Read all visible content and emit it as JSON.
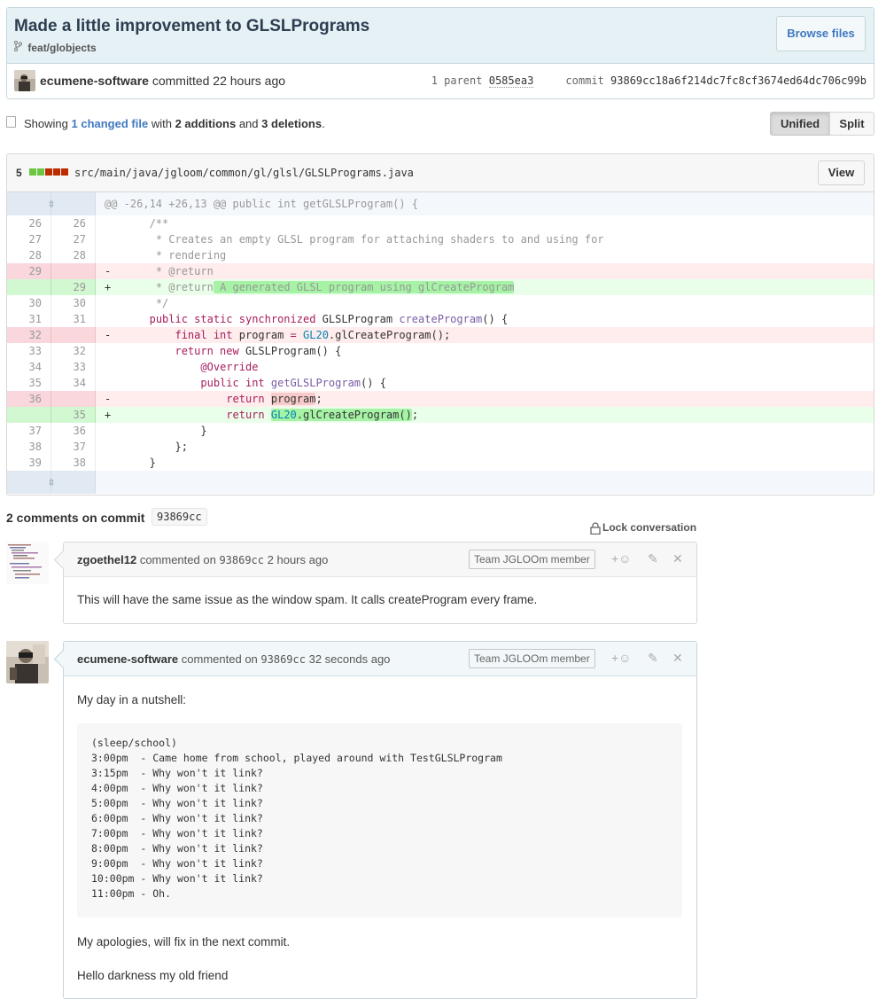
{
  "commit": {
    "title": "Made a little improvement to GLSLPrograms",
    "branch": "feat/globjects",
    "browse_label": "Browse files",
    "author": "ecumene-software",
    "action": "committed",
    "time": "22 hours ago",
    "parent_label": "1 parent",
    "parent_sha": "0585ea3",
    "commit_label": "commit",
    "commit_sha": "93869cc18a6f214dc7fc8cf3674ed64dc706c99b"
  },
  "toc": {
    "prefix": "Showing",
    "changed": "1 changed file",
    "with": "with",
    "additions": "2 additions",
    "and": "and",
    "deletions": "3 deletions",
    "period": "."
  },
  "view_toggle": {
    "unified": "Unified",
    "split": "Split"
  },
  "file": {
    "stat": "5",
    "path": "src/main/java/jgloom/common/gl/glsl/GLSLPrograms.java",
    "view_label": "View",
    "hunk": "@@ -26,14 +26,13 @@ public int getGLSLProgram() {",
    "line_numbers": [
      [
        "26",
        "26"
      ],
      [
        "27",
        "27"
      ],
      [
        "28",
        "28"
      ],
      [
        "29",
        ""
      ],
      [
        "",
        "29"
      ],
      [
        "30",
        "30"
      ],
      [
        "31",
        "31"
      ],
      [
        "32",
        ""
      ],
      [
        "33",
        "32"
      ],
      [
        "34",
        "33"
      ],
      [
        "35",
        "34"
      ],
      [
        "36",
        ""
      ],
      [
        "",
        "35"
      ],
      [
        "37",
        "36"
      ],
      [
        "38",
        "37"
      ],
      [
        "39",
        "38"
      ]
    ],
    "markers": [
      " ",
      " ",
      " ",
      "-",
      "+",
      " ",
      " ",
      "-",
      " ",
      " ",
      " ",
      "-",
      "+",
      " ",
      " ",
      " "
    ]
  },
  "comments_header": {
    "title": "2 comments on commit",
    "sha": "93869cc",
    "lock_label": "Lock conversation"
  },
  "comments": [
    {
      "author": "zgoethel12",
      "action": "commented on",
      "sha": "93869cc",
      "time": "2 hours ago",
      "badge": "Team JGLOOm member",
      "body": "This will have the same issue as the window spam. It calls createProgram every frame."
    },
    {
      "author": "ecumene-software",
      "action": "commented on",
      "sha": "93869cc",
      "time": "32 seconds ago",
      "badge": "Team JGLOOm member",
      "intro": "My day in a nutshell:",
      "log": "(sleep/school)\n3:00pm  - Came home from school, played around with TestGLSLProgram\n3:15pm  - Why won't it link?\n4:00pm  - Why won't it link?\n5:00pm  - Why won't it link?\n6:00pm  - Why won't it link?\n7:00pm  - Why won't it link?\n8:00pm  - Why won't it link?\n9:00pm  - Why won't it link?\n10:00pm - Why won't it link?\n11:00pm - Oh.",
      "apology": "My apologies, will fix in the next commit.",
      "closing": "Hello darkness my old friend"
    }
  ]
}
